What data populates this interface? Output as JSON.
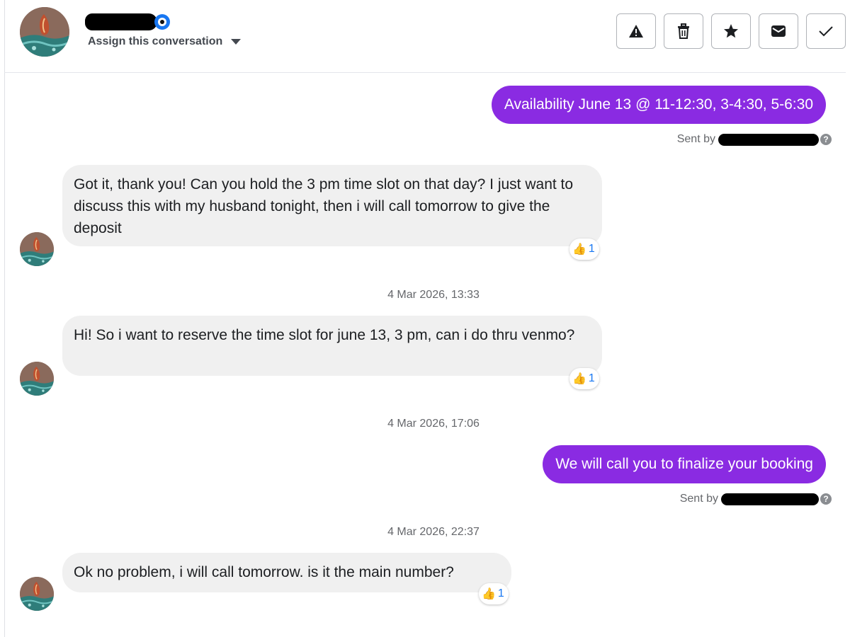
{
  "header": {
    "assign_label": "Assign this conversation",
    "toolbar": [
      {
        "name": "report-button",
        "icon": "warning-icon"
      },
      {
        "name": "delete-button",
        "icon": "trash-icon"
      },
      {
        "name": "star-button",
        "icon": "star-icon"
      },
      {
        "name": "mark-unread-button",
        "icon": "envelope-icon"
      },
      {
        "name": "mark-done-button",
        "icon": "checkmark-icon"
      }
    ]
  },
  "colors": {
    "outgoing_bubble": "#8a2be2",
    "incoming_bubble": "#f0f0f0",
    "reaction_count": "#1877f2"
  },
  "messages": [
    {
      "direction": "outgoing",
      "text": "Availability June 13 @ 11-12:30, 3-4:30, 5-6:30",
      "sent_by_label": "Sent by"
    },
    {
      "direction": "incoming",
      "text": "Got it, thank you! Can you hold the 3 pm time slot on that day? I just want to discuss this with my husband tonight, then i will call tomorrow to give the deposit",
      "reaction": {
        "icon": "thumbs-up-icon",
        "count": "1"
      }
    },
    {
      "direction": "timestamp",
      "text": "4 Mar 2026, 13:33"
    },
    {
      "direction": "incoming",
      "text": "Hi! So i want to reserve the time slot for june 13, 3 pm, can i do thru venmo?",
      "reaction": {
        "icon": "thumbs-up-icon",
        "count": "1"
      }
    },
    {
      "direction": "timestamp",
      "text": "4 Mar 2026, 17:06"
    },
    {
      "direction": "outgoing",
      "text": "We will call you to finalize your booking",
      "sent_by_label": "Sent by"
    },
    {
      "direction": "timestamp",
      "text": "4 Mar 2026, 22:37"
    },
    {
      "direction": "incoming",
      "text": "Ok no problem, i will call tomorrow. is it the main number?",
      "reaction": {
        "icon": "thumbs-up-icon",
        "count": "1"
      }
    }
  ]
}
